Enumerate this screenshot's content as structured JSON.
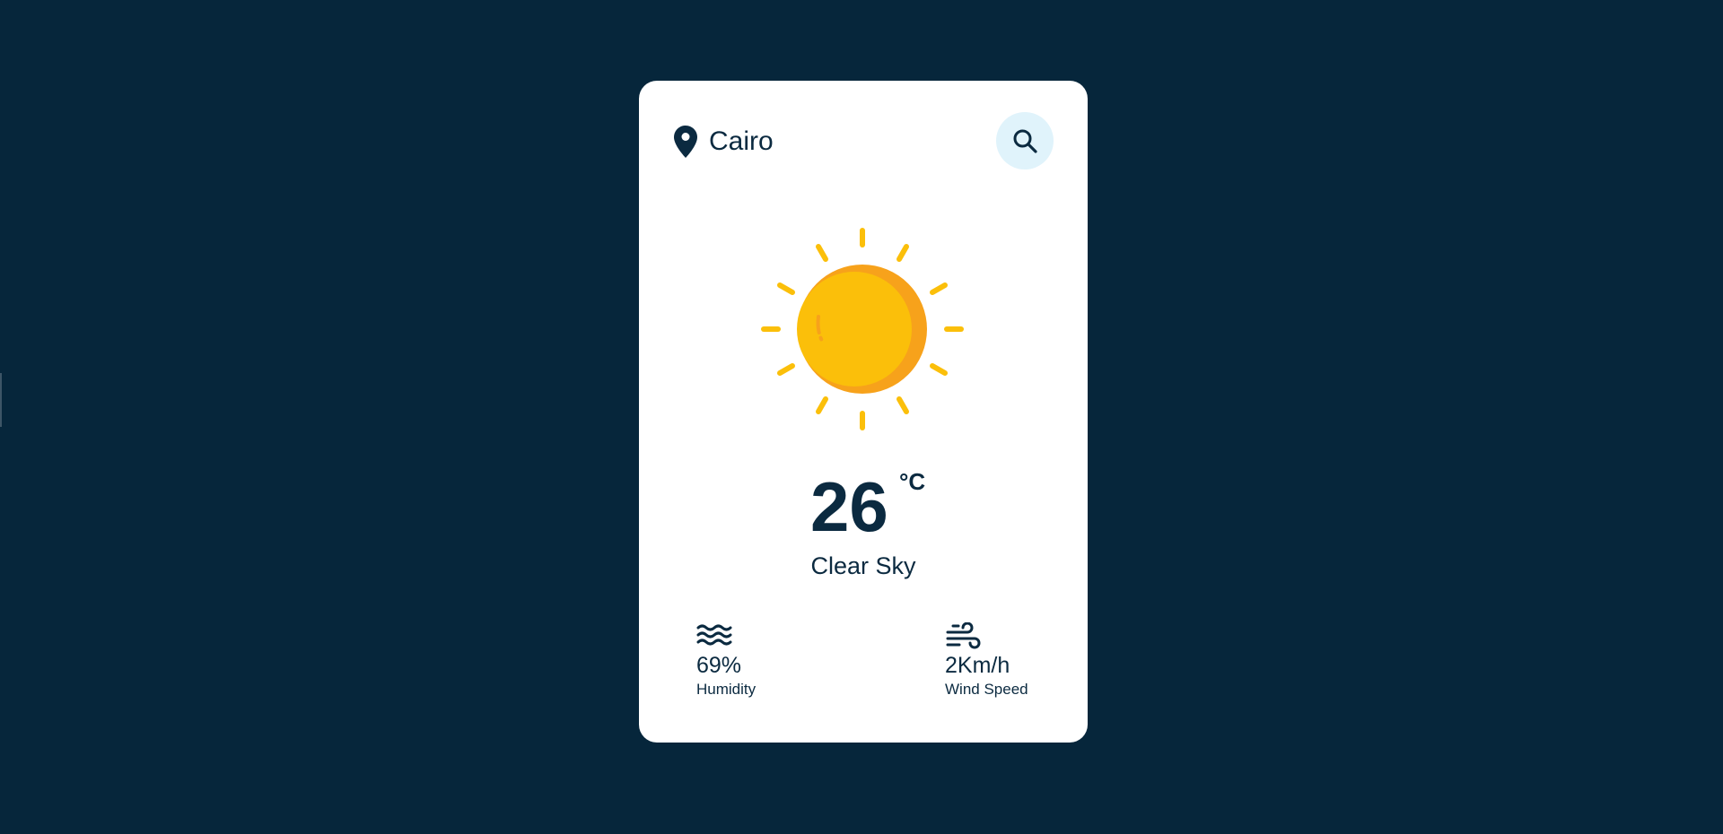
{
  "location": {
    "city": "Cairo",
    "icon": "map-pin-icon"
  },
  "search": {
    "icon": "search-icon"
  },
  "weather": {
    "icon": "sun-icon",
    "temperature": "26",
    "unit": "°C",
    "condition": "Clear Sky"
  },
  "stats": {
    "humidity": {
      "value": "69%",
      "label": "Humidity",
      "icon": "waves-icon"
    },
    "wind": {
      "value": "2Km/h",
      "label": "Wind Speed",
      "icon": "wind-icon"
    }
  },
  "colors": {
    "background": "#06263b",
    "card": "#ffffff",
    "text": "#0b2a40",
    "sun": "#fbbf0a",
    "sun_shade": "#f7a21b",
    "search_bg": "#e0f3fb"
  }
}
